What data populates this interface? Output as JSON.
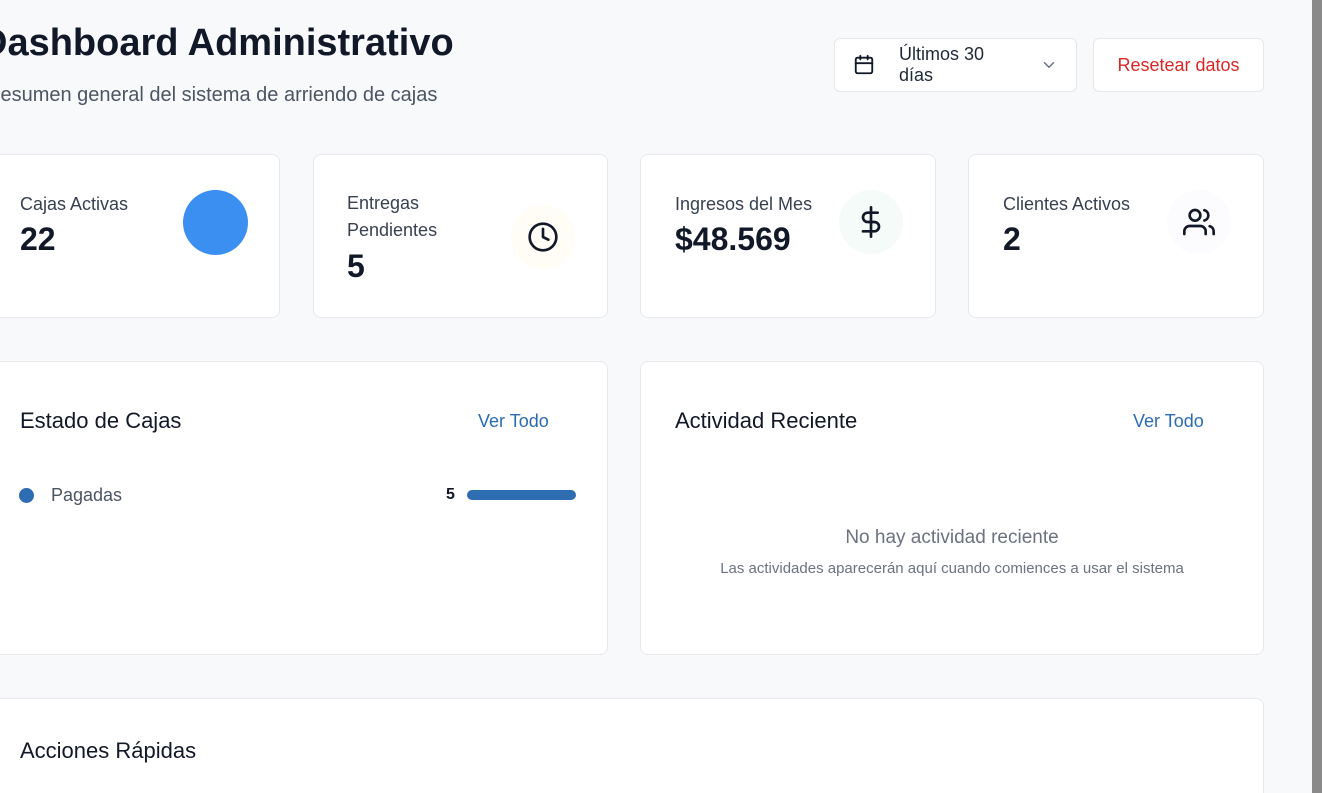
{
  "header": {
    "title": "Dashboard Administrativo",
    "subtitle": "Resumen general del sistema de arriendo de cajas",
    "date_range": "Últimos 30 días",
    "reset_label": "Resetear datos"
  },
  "stats": [
    {
      "label": "Cajas Activas",
      "value": "22",
      "icon": "circle-icon",
      "icon_color": "#3b8ff0"
    },
    {
      "label_line1": "Entregas",
      "label_line2": "Pendientes",
      "value": "5",
      "icon": "clock-icon"
    },
    {
      "label": "Ingresos del Mes",
      "value": "$48.569",
      "icon": "dollar-icon"
    },
    {
      "label": "Clientes Activos",
      "value": "2",
      "icon": "users-icon"
    }
  ],
  "estado_cajas": {
    "title": "Estado de Cajas",
    "link": "Ver Todo",
    "items": [
      {
        "label": "Pagadas",
        "count": "5",
        "fraction": 1.0,
        "color": "#2f6db2"
      }
    ]
  },
  "actividad": {
    "title": "Actividad Reciente",
    "link": "Ver Todo",
    "empty_title": "No hay actividad reciente",
    "empty_subtitle": "Las actividades aparecerán aquí cuando comiences a usar el sistema"
  },
  "acciones": {
    "title": "Acciones Rápidas"
  },
  "colors": {
    "accent": "#2b6cb0",
    "danger": "#dc2626",
    "bar": "#2f6db2"
  }
}
